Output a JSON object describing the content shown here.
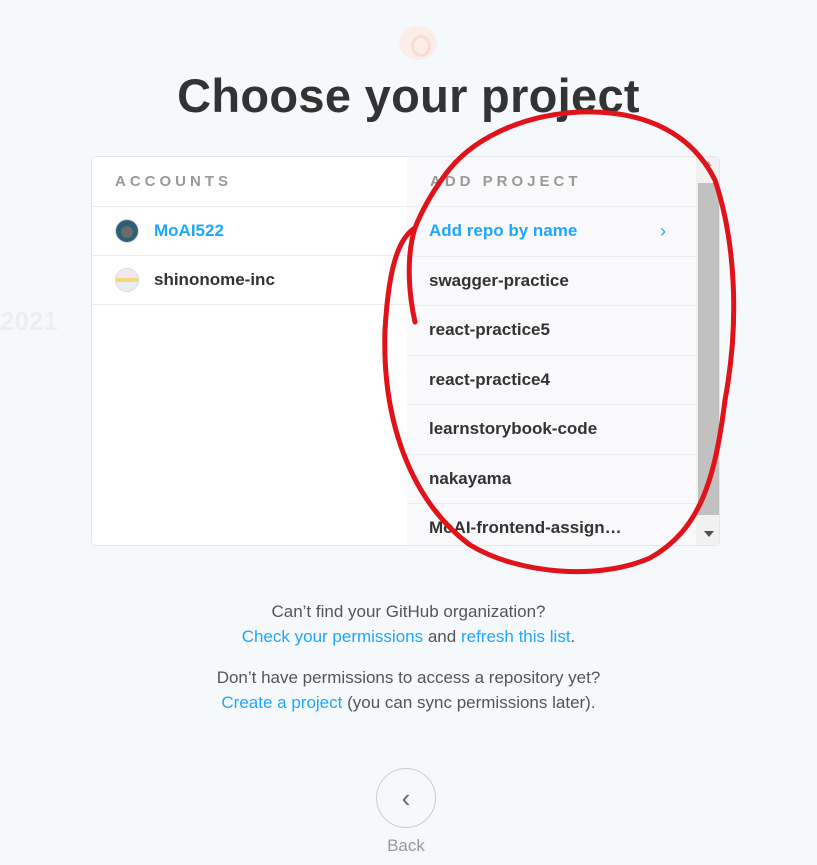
{
  "page": {
    "title": "Choose your project",
    "ghost_year": "2021"
  },
  "accounts": {
    "header": "ACCOUNTS",
    "items": [
      {
        "name": "MoAI522",
        "active": true
      },
      {
        "name": "shinonome-inc",
        "active": false
      }
    ]
  },
  "projects": {
    "header": "ADD PROJECT",
    "add_repo_label": "Add repo by name",
    "items": [
      "swagger-practice",
      "react-practice5",
      "react-practice4",
      "learnstorybook-code",
      "nakayama",
      "MoAI-frontend-assign…"
    ]
  },
  "help": {
    "org_question": "Can’t find your GitHub organization?",
    "check_permissions": "Check your permissions",
    "and": "and",
    "refresh_list": "refresh this list",
    "period": ".",
    "repo_question": "Don’t have permissions to access a repository yet?",
    "create_project": "Create a project",
    "sync_note": "(you can sync permissions later)."
  },
  "back": {
    "label": "Back"
  },
  "colors": {
    "accent": "#1ea7fd",
    "annotation": "#e0121a"
  }
}
